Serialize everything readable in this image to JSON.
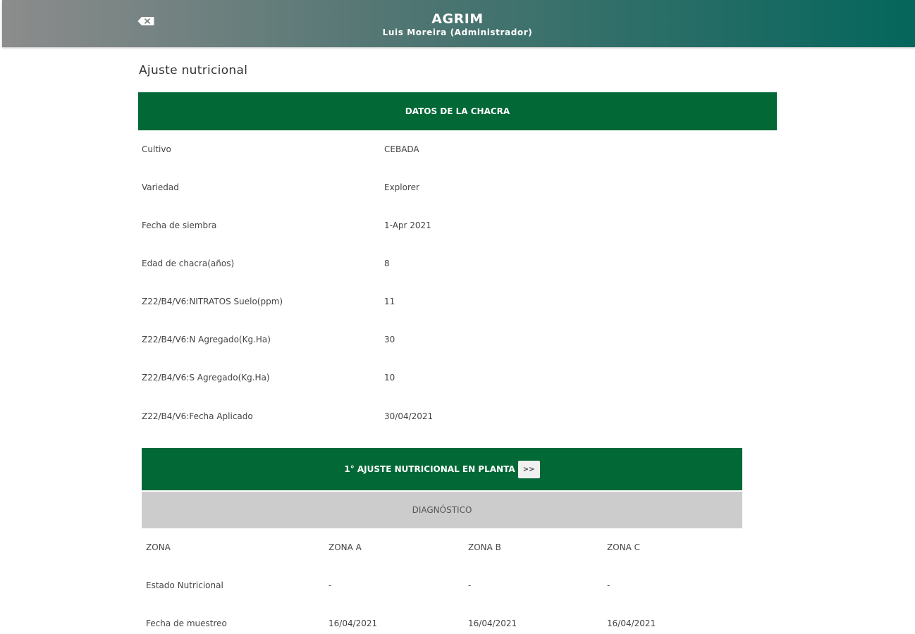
{
  "header": {
    "app_title": "AGRIM",
    "user": "Luis Moreira (Administrador)",
    "back_icon": "backspace-icon"
  },
  "page_title": "Ajuste nutricional",
  "chacra": {
    "section_title": "DATOS DE LA CHACRA",
    "rows": [
      {
        "label": "Cultivo",
        "value": "CEBADA"
      },
      {
        "label": "Variedad",
        "value": "Explorer"
      },
      {
        "label": "Fecha de siembra",
        "value": "1-Apr 2021"
      },
      {
        "label": "Edad de chacra(años)",
        "value": "8"
      },
      {
        "label": "Z22/B4/V6:NITRATOS Suelo(ppm)",
        "value": "11"
      },
      {
        "label": "Z22/B4/V6:N Agregado(Kg.Ha)",
        "value": "30"
      },
      {
        "label": "Z22/B4/V6:S Agregado(Kg.Ha)",
        "value": "10"
      },
      {
        "label": "Z22/B4/V6:Fecha Aplicado",
        "value": "30/04/2021"
      }
    ]
  },
  "ajuste": {
    "section_title": "1° AJUSTE NUTRICIONAL EN PLANTA",
    "next_button": ">>",
    "diagnostico": "DIAGNÓSTICO",
    "table": {
      "headers": [
        "ZONA",
        "ZONA A",
        "ZONA B",
        "ZONA C"
      ],
      "rows": [
        [
          "Estado Nutricional",
          "-",
          "-",
          "-"
        ],
        [
          "Fecha de muestreo",
          "16/04/2021",
          "16/04/2021",
          "16/04/2021"
        ]
      ]
    }
  },
  "colors": {
    "primary_green": "#016836",
    "header_gradient_start": "#8c8c8c",
    "header_gradient_end": "#04665c",
    "diag_gray": "#cccccc"
  }
}
